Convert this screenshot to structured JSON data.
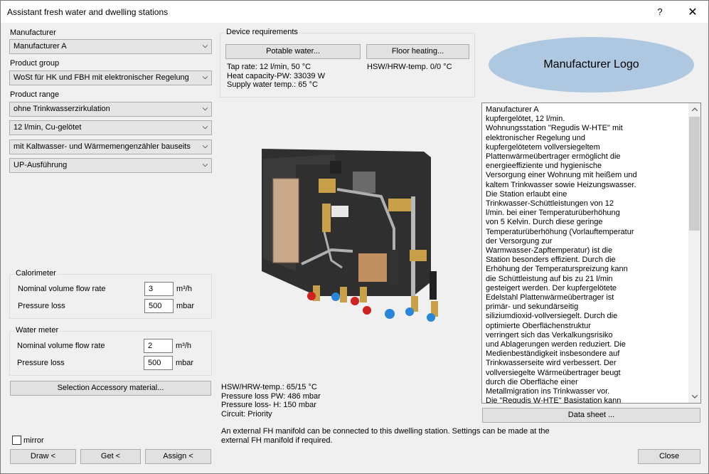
{
  "window": {
    "title": "Assistant fresh water and dwelling stations",
    "help_label": "?",
    "close_label": "✕"
  },
  "left": {
    "manufacturer_label": "Manufacturer",
    "manufacturer_value": "Manufacturer A",
    "product_group_label": "Product group",
    "product_group_value": "WoSt für HK und FBH mit elektronischer Regelung",
    "product_range_label": "Product range",
    "product_range_values": [
      "ohne Trinkwasserzirkulation",
      "12 l/min, Cu-gelötet",
      "mit Kaltwasser- und Wärmemengenzähler bauseits",
      "UP-Ausführung"
    ],
    "calorimeter": {
      "title": "Calorimeter",
      "flow_label": "Nominal volume flow rate",
      "flow_value": "3",
      "flow_unit": "m³/h",
      "pressure_label": "Pressure loss",
      "pressure_value": "500",
      "pressure_unit": "mbar"
    },
    "water_meter": {
      "title": "Water meter",
      "flow_label": "Nominal volume flow rate",
      "flow_value": "2",
      "flow_unit": "m³/h",
      "pressure_label": "Pressure loss",
      "pressure_value": "500",
      "pressure_unit": "mbar"
    },
    "accessory_button": "Selection Accessory material...",
    "mirror_label": "mirror",
    "mirror_checked": false,
    "draw_button": "Draw <",
    "get_button": "Get <",
    "assign_button": "Assign <"
  },
  "device_requirements": {
    "title": "Device requirements",
    "potable_water_button": "Potable water...",
    "floor_heating_button": "Floor heating...",
    "potable_lines": [
      "Tap rate: 12 l/min, 50 °C",
      "Heat capacity-PW: 33039 W",
      "Supply water temp.: 65 °C"
    ],
    "floor_heating_line": "HSW/HRW-temp. 0/0 °C"
  },
  "results": {
    "lines": [
      "HSW/HRW-temp.: 65/15 °C",
      "Pressure loss PW: 486 mbar",
      "Pressure loss- H: 150 mbar",
      "Circuit: Priority"
    ],
    "note": "An external FH manifold can be connected to this dwelling station. Settings can be made at the\nexternal FH manifold if required."
  },
  "right": {
    "logo_text": "Manufacturer Logo",
    "logo_color": "#adc8e0",
    "description": "Manufacturer A\nkupfergelötet, 12 l/min.\nWohnungsstation \"Regudis W-HTE\" mit\nelektronischer Regelung und\nkupfergelötetem vollversiegeltem\nPlattenwärmeübertrager ermöglicht die\nenergieeffiziente und hygienische\nVersorgung einer Wohnung mit heißem und\nkaltem Trinkwasser sowie Heizungswasser.\nDie Station erlaubt eine\nTrinkwasser-Schüttleistungen von 12\nl/min. bei einer Temperaturüberhöhung\nvon 5 Kelvin. Durch diese geringe\nTemperaturüberhöhung (Vorlauftemperatur\nder Versorgung zur\nWarmwasser-Zapftemperatur) ist die\nStation besonders effizient. Durch die\nErhöhung der Temperaturspreizung kann\ndie Schüttleistung auf bis zu 21 l/min\ngesteigert werden. Der kupfergelötete\nEdelstahl Plattenwärmeübertrager ist\nprimär- und sekundärseitig\nsiliziumdioxid-vollversiegelt. Durch die\noptimierte Oberflächenstruktur\nverringert sich das Verkalkungsrisiko\nund Ablagerungen werden reduziert. Die\nMedienbeständigkeit insbesondere auf\nTrinkwasserseite wird verbessert. Der\nvollversiegelte Wärmeübertrager beugt\ndurch die Oberfläche einer\nMetallmigration ins Trinkwasser vor.\nDie \"Regudis W-HTE\" Basistation kann",
    "data_sheet_button": "Data sheet ...",
    "close_button": "Close"
  }
}
